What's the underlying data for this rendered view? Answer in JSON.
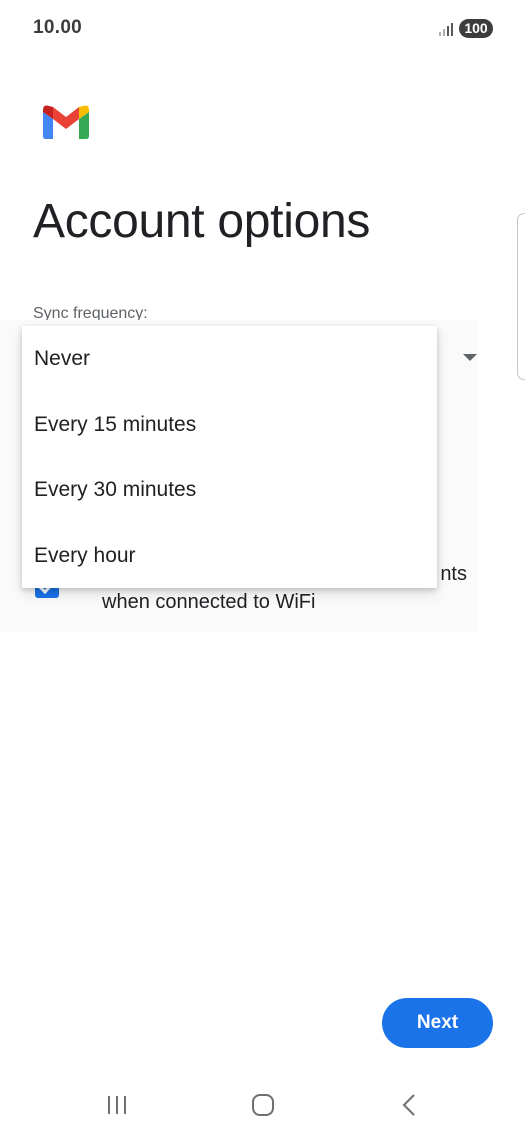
{
  "status_bar": {
    "time": "10.00",
    "battery": "100"
  },
  "logo": {
    "icon": "gmail-icon",
    "colors": {
      "red": "#ea4335",
      "blue": "#4285f4",
      "green": "#34a853",
      "yellow": "#fbbc04"
    }
  },
  "page": {
    "title": "Account options"
  },
  "sync": {
    "label": "Sync frequency:"
  },
  "dropdown": {
    "options": [
      "Never",
      "Every 15 minutes",
      "Every 30 minutes",
      "Every hour"
    ]
  },
  "checkbox": {
    "checked": true,
    "label_line1": "nts",
    "label_line2": "when connected to WiFi"
  },
  "actions": {
    "next_label": "Next"
  },
  "nav": {
    "recent_icon": "recent-apps-icon",
    "home_icon": "home-icon",
    "back_icon": "back-icon"
  },
  "colors": {
    "accent": "#1a73e8"
  }
}
